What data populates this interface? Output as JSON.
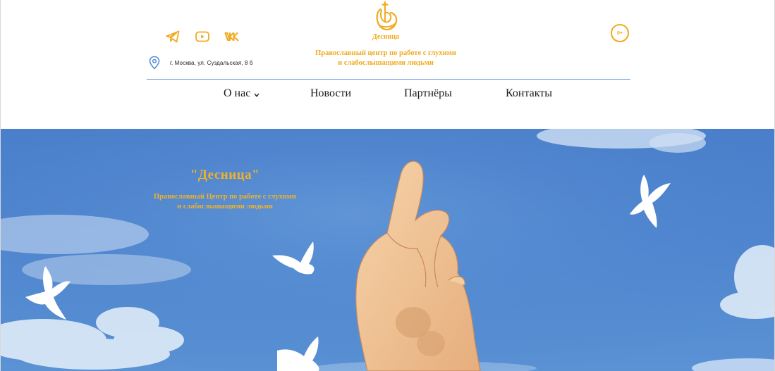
{
  "header": {
    "social": [
      {
        "name": "telegram",
        "icon": "telegram-icon"
      },
      {
        "name": "youtube",
        "icon": "youtube-icon"
      },
      {
        "name": "vk",
        "icon": "vk-icon"
      }
    ],
    "address": "г. Москва, ул. Суздальская, 8 б",
    "logo_name": "Десница",
    "tagline_line1": "Православный центр по работе с глухими",
    "tagline_line2": "и слабослышащими людьми",
    "age_rating": "0+"
  },
  "nav": {
    "items": [
      {
        "label": "О нас",
        "has_dropdown": true
      },
      {
        "label": "Новости",
        "has_dropdown": false
      },
      {
        "label": "Партнёры",
        "has_dropdown": false
      },
      {
        "label": "Контакты",
        "has_dropdown": false
      }
    ]
  },
  "hero": {
    "title": "\"Десница\"",
    "subtitle_line1": "Православный Центр по работе с глухими",
    "subtitle_line2": "и слабослышащими людьми"
  },
  "colors": {
    "accent": "#f0ab1e",
    "divider": "#5b8fd8",
    "sky": "#4f86cf",
    "pin": "#5b8fd8"
  }
}
